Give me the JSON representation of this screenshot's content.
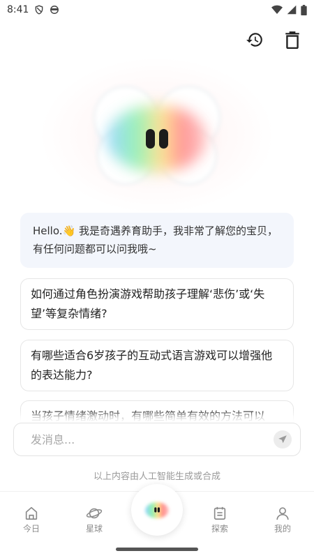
{
  "status_bar": {
    "time": "8:41",
    "left_icons": [
      "shield-icon",
      "face-icon"
    ],
    "right_icons": [
      "wifi-icon",
      "signal-icon",
      "battery-icon"
    ]
  },
  "header": {
    "actions": [
      "history-icon",
      "trash-icon"
    ]
  },
  "chat": {
    "greeting": "Hello.👋 我是奇遇养育助手，我非常了解您的宝贝，有任何问题都可以问我哦~",
    "suggestions": [
      "如何通过角色扮演游戏帮助孩子理解‘悲伤’或‘失望’等复杂情绪?",
      "有哪些适合6岁孩子的互动式语言游戏可以增强他的表达能力?",
      "当孩子情绪激动时，有哪些简单有效的方法可以"
    ]
  },
  "input": {
    "placeholder": "发消息..."
  },
  "footer_note": "以上内容由人工智能生成或合成",
  "tabbar": {
    "tabs": [
      {
        "label": "今日",
        "icon": "home-icon"
      },
      {
        "label": "星球",
        "icon": "planet-icon"
      },
      {
        "label": "探索",
        "icon": "calendar-icon"
      },
      {
        "label": "我的",
        "icon": "profile-icon"
      }
    ],
    "center_icon": "mascot-icon"
  },
  "colors": {
    "greeting_bg": "#f3f6fc",
    "border": "#e6e6e6",
    "muted_text": "#9a9a9a"
  }
}
